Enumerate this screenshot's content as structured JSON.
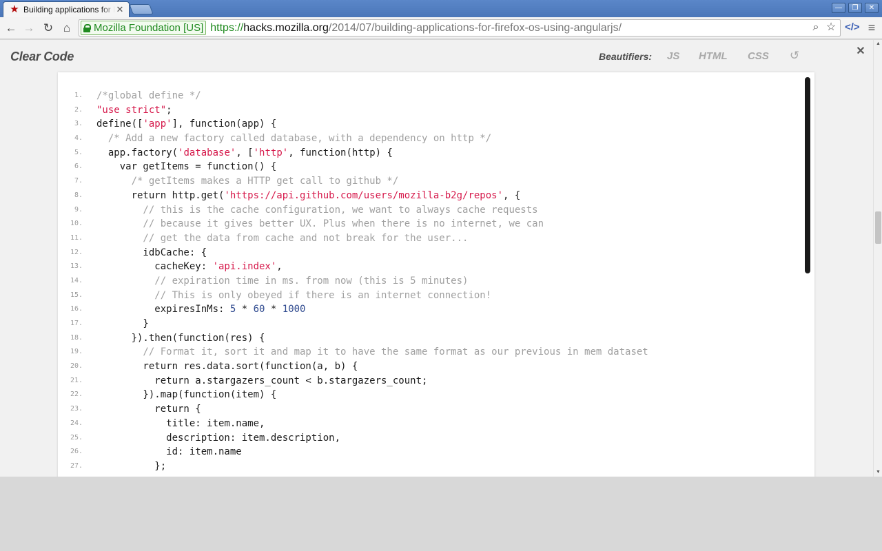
{
  "browser": {
    "tab_title": "Building applications for Firefox OS using AngularJS",
    "tab_favicon": "star-icon",
    "ev_label": "Mozilla Foundation [US]",
    "url_scheme": "https://",
    "url_host": "hacks.mozilla.org",
    "url_path": "/2014/07/building-applications-for-firefox-os-using-angularjs/"
  },
  "clear_code": {
    "title": "Clear Code",
    "beautifiers_label": "Beautifiers:",
    "buttons": [
      "JS",
      "HTML",
      "CSS"
    ]
  },
  "code_lines": [
    {
      "n": "1.",
      "parts": [
        {
          "c": "cm",
          "t": "/*global define */"
        }
      ]
    },
    {
      "n": "2.",
      "parts": [
        {
          "c": "st",
          "t": "\"use strict\""
        },
        {
          "c": "txt",
          "t": ";"
        }
      ]
    },
    {
      "n": "3.",
      "parts": [
        {
          "c": "txt",
          "t": "define(["
        },
        {
          "c": "st",
          "t": "'app'"
        },
        {
          "c": "txt",
          "t": "], function(app) {"
        }
      ]
    },
    {
      "n": "4.",
      "parts": [
        {
          "c": "cm",
          "t": "  /* Add a new factory called database, with a dependency on http */"
        }
      ]
    },
    {
      "n": "5.",
      "parts": [
        {
          "c": "txt",
          "t": "  app.factory("
        },
        {
          "c": "st",
          "t": "'database'"
        },
        {
          "c": "txt",
          "t": ", ["
        },
        {
          "c": "st",
          "t": "'http'"
        },
        {
          "c": "txt",
          "t": ", function(http) {"
        }
      ]
    },
    {
      "n": "6.",
      "parts": [
        {
          "c": "txt",
          "t": "    var getItems = function() {"
        }
      ]
    },
    {
      "n": "7.",
      "parts": [
        {
          "c": "cm",
          "t": "      /* getItems makes a HTTP get call to github */"
        }
      ]
    },
    {
      "n": "8.",
      "parts": [
        {
          "c": "txt",
          "t": "      return http.get("
        },
        {
          "c": "st",
          "t": "'https://api.github.com/users/mozilla-b2g/repos'"
        },
        {
          "c": "txt",
          "t": ", {"
        }
      ]
    },
    {
      "n": "9.",
      "parts": [
        {
          "c": "cm",
          "t": "        // this is the cache configuration, we want to always cache requests"
        }
      ]
    },
    {
      "n": "10.",
      "parts": [
        {
          "c": "cm",
          "t": "        // because it gives better UX. Plus when there is no internet, we can"
        }
      ]
    },
    {
      "n": "11.",
      "parts": [
        {
          "c": "cm",
          "t": "        // get the data from cache and not break for the user..."
        }
      ]
    },
    {
      "n": "12.",
      "parts": [
        {
          "c": "txt",
          "t": "        idbCache: {"
        }
      ]
    },
    {
      "n": "13.",
      "parts": [
        {
          "c": "txt",
          "t": "          cacheKey: "
        },
        {
          "c": "st",
          "t": "'api.index'"
        },
        {
          "c": "txt",
          "t": ","
        }
      ]
    },
    {
      "n": "14.",
      "parts": [
        {
          "c": "cm",
          "t": "          // expiration time in ms. from now (this is 5 minutes)"
        }
      ]
    },
    {
      "n": "15.",
      "parts": [
        {
          "c": "cm",
          "t": "          // This is only obeyed if there is an internet connection!"
        }
      ]
    },
    {
      "n": "16.",
      "parts": [
        {
          "c": "txt",
          "t": "          expiresInMs: "
        },
        {
          "c": "nm",
          "t": "5"
        },
        {
          "c": "txt",
          "t": " * "
        },
        {
          "c": "nm",
          "t": "60"
        },
        {
          "c": "txt",
          "t": " * "
        },
        {
          "c": "nm",
          "t": "1000"
        }
      ]
    },
    {
      "n": "17.",
      "parts": [
        {
          "c": "txt",
          "t": "        }"
        }
      ]
    },
    {
      "n": "18.",
      "parts": [
        {
          "c": "txt",
          "t": "      }).then(function(res) {"
        }
      ]
    },
    {
      "n": "19.",
      "parts": [
        {
          "c": "cm",
          "t": "        // Format it, sort it and map it to have the same format as our previous in mem dataset"
        }
      ]
    },
    {
      "n": "20.",
      "parts": [
        {
          "c": "txt",
          "t": "        return res.data.sort(function(a, b) {"
        }
      ]
    },
    {
      "n": "21.",
      "parts": [
        {
          "c": "txt",
          "t": "          return a.stargazers_count < b.stargazers_count;"
        }
      ]
    },
    {
      "n": "22.",
      "parts": [
        {
          "c": "txt",
          "t": "        }).map(function(item) {"
        }
      ]
    },
    {
      "n": "23.",
      "parts": [
        {
          "c": "txt",
          "t": "          return {"
        }
      ]
    },
    {
      "n": "24.",
      "parts": [
        {
          "c": "txt",
          "t": "            title: item.name,"
        }
      ]
    },
    {
      "n": "25.",
      "parts": [
        {
          "c": "txt",
          "t": "            description: item.description,"
        }
      ]
    },
    {
      "n": "26.",
      "parts": [
        {
          "c": "txt",
          "t": "            id: item.name"
        }
      ]
    },
    {
      "n": "27.",
      "parts": [
        {
          "c": "txt",
          "t": "          };"
        }
      ]
    }
  ]
}
